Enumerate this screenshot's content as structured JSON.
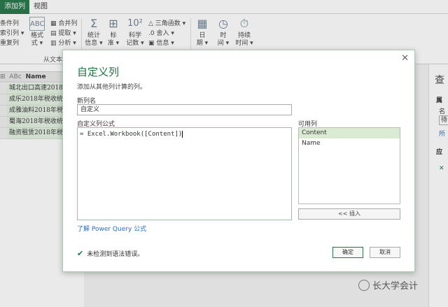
{
  "ribbon": {
    "tabs": [
      {
        "label": "添加列",
        "active": true
      },
      {
        "label": "视图",
        "active": false
      }
    ],
    "left_items": [
      "条件列",
      "索引列 ▾",
      "重复列"
    ],
    "merge_col": "合并列",
    "extract": "提取 ▾",
    "analyze": "分析 ▾",
    "format": "格式",
    "format_sub": "式 ▾",
    "stats": "统计",
    "stats_sub": "信息 ▾",
    "standard": "标",
    "standard_sub": "准 ▾",
    "scientific": "科学",
    "scientific_sub": "记数 ▾",
    "trig": "三角函数 ▾",
    "rounding": "舍入 ▾",
    "info": "信息 ▾",
    "date": "日",
    "date_sub": "期 ▾",
    "time": "时",
    "time_sub": "间 ▾",
    "duration": "持续",
    "duration_sub": "时间 ▾",
    "group_from_text": "从文本"
  },
  "grid": {
    "header": "Name",
    "rows": [
      "城北出口高速2018年",
      "成乐2018年税收统计",
      "成雅油料2018年税收",
      "蜀海2018年税收统计",
      "融资租赁2018年税收"
    ]
  },
  "right_pane": {
    "title": "查",
    "props": "属",
    "name_lbl": "名",
    "name_val": "待",
    "all": "所",
    "applied": "应",
    "x": "✕"
  },
  "dialog": {
    "title": "自定义列",
    "subtitle": "添加从其他列计算的列。",
    "new_col_label": "新列名",
    "new_col_value": "自定义",
    "formula_label": "自定义列公式",
    "formula": "= Excel.Workbook([Content])",
    "available_label": "可用列",
    "available": [
      "Content",
      "Name"
    ],
    "insert": "<< 插入",
    "help": "了解 Power Query 公式",
    "status": "未检测到语法错误。",
    "ok": "确定",
    "cancel": "取消",
    "close": "✕"
  },
  "watermark": "长大学会计"
}
